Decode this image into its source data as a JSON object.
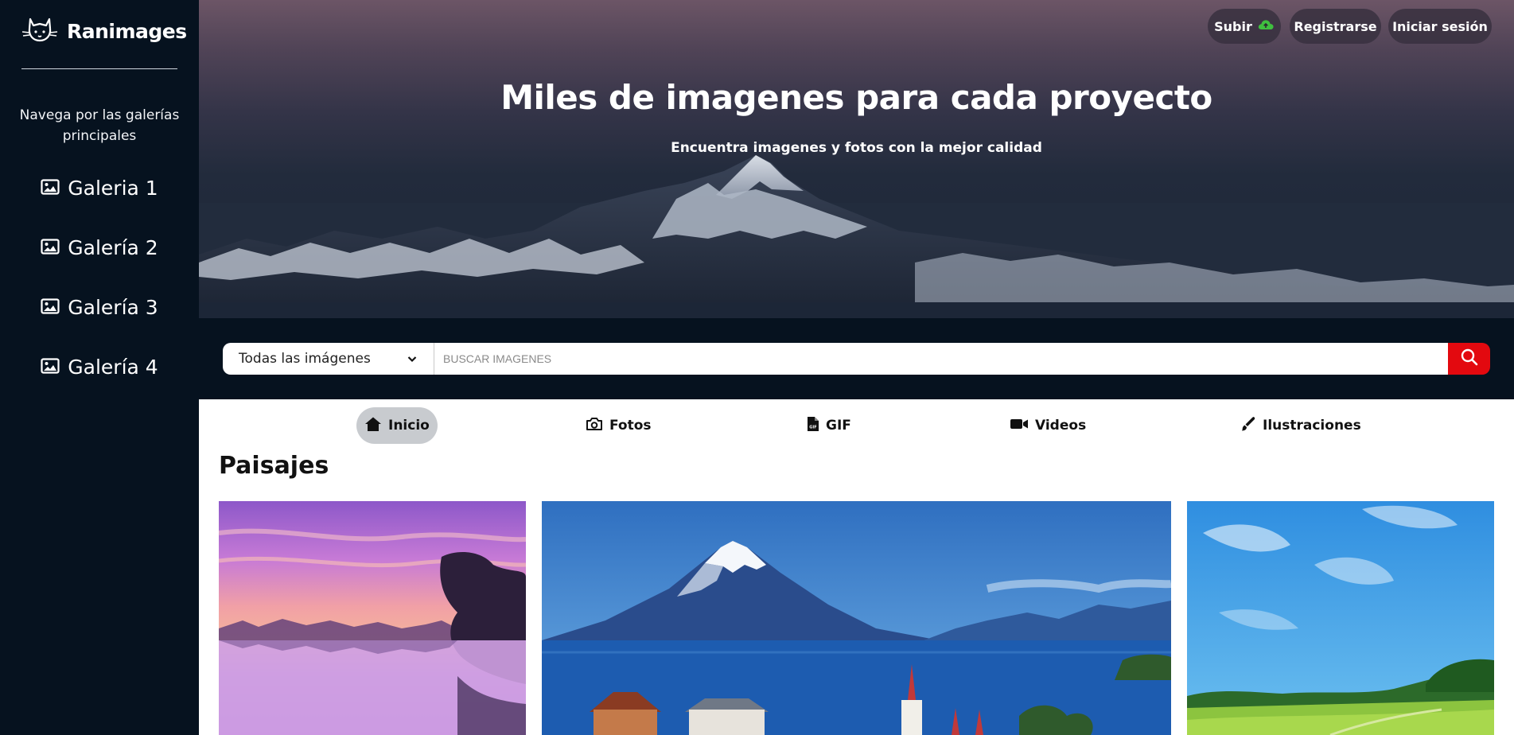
{
  "brand": {
    "name": "Ranimages"
  },
  "sidebar": {
    "intro": "Navega por las galerías principales",
    "items": [
      {
        "label": "Galeria 1",
        "icon": "image-icon"
      },
      {
        "label": "Galería 2",
        "icon": "image-icon"
      },
      {
        "label": "Galería 3",
        "icon": "image-icon"
      },
      {
        "label": "Galería 4",
        "icon": "image-icon"
      }
    ]
  },
  "header": {
    "upload_label": "Subir",
    "register_label": "Registrarse",
    "login_label": "Iniciar sesión"
  },
  "hero": {
    "title": "Miles de imagenes para cada proyecto",
    "subtitle": "Encuentra imagenes y fotos con la mejor calidad"
  },
  "search": {
    "selected_option": "Todas las imágenes",
    "placeholder": "BUSCAR IMAGENES",
    "value": ""
  },
  "tabs": [
    {
      "label": "Inicio",
      "icon": "home-icon",
      "active": true
    },
    {
      "label": "Fotos",
      "icon": "camera-icon",
      "active": false
    },
    {
      "label": "GIF",
      "icon": "gif-file-icon",
      "active": false
    },
    {
      "label": "Videos",
      "icon": "video-camera-icon",
      "active": false
    },
    {
      "label": "Ilustraciones",
      "icon": "brush-icon",
      "active": false
    }
  ],
  "content": {
    "section_title": "Paisajes"
  },
  "colors": {
    "sidebar_bg": "#06121f",
    "search_button": "#e3090f",
    "upload_icon": "#3fbf3f",
    "active_tab_bg": "#c8cbcf"
  }
}
